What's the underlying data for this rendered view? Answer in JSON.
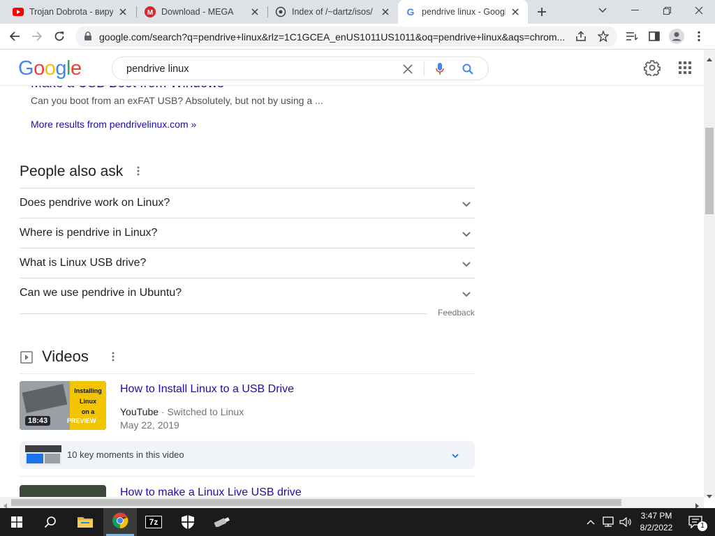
{
  "browser": {
    "tabs": [
      {
        "title": "Trojan Dobrota - вирус",
        "favicon": "youtube-icon"
      },
      {
        "title": "Download - MEGA",
        "favicon": "mega-icon"
      },
      {
        "title": "Index of /~dartz/isos/",
        "favicon": "site-icon"
      },
      {
        "title": "pendrive linux - Google",
        "favicon": "google-icon",
        "active": true
      }
    ],
    "new_tab": "+",
    "url": "google.com/search?q=pendrive+linux&rlz=1C1GCEA_enUS1011US1011&oq=pendrive+linux&aqs=chrom..."
  },
  "google": {
    "logo": "Google",
    "query": "pendrive linux",
    "colors": {
      "blue": "#4285f4",
      "red": "#ea4335",
      "yellow": "#fbbc05",
      "green": "#34a853",
      "link": "#1a0dab"
    }
  },
  "results": {
    "top_link": "Make a USB Boot from Windows",
    "top_snippet": "Can you boot from an exFAT USB? Absolutely, but not by using a ...",
    "more_results": "More results from pendrivelinux.com »"
  },
  "paa": {
    "title": "People also ask",
    "questions": [
      "Does pendrive work on Linux?",
      "Where is pendrive in Linux?",
      "What is Linux USB drive?",
      "Can we use pendrive in Ubuntu?"
    ],
    "feedback": "Feedback"
  },
  "videos": {
    "title": "Videos",
    "items": [
      {
        "title": "How to Install Linux to a USB Drive",
        "source": "YouTube",
        "channel": "Switched to Linux",
        "date": "May 22, 2019",
        "duration": "18:43",
        "badge": "PREVIEW",
        "thumb_text": [
          "Installing",
          "Linux",
          "on a"
        ],
        "key_moments": "10 key moments in this video"
      },
      {
        "title": "How to make a Linux Live USB drive"
      }
    ]
  },
  "taskbar": {
    "time": "3:47 PM",
    "date": "8/2/2022",
    "notifications": "1",
    "apps": [
      "start-icon",
      "search-icon",
      "file-explorer-icon",
      "chrome-icon",
      "7zip-icon",
      "security-icon",
      "usb-tool-icon"
    ],
    "sevenzip_label": "7z"
  }
}
